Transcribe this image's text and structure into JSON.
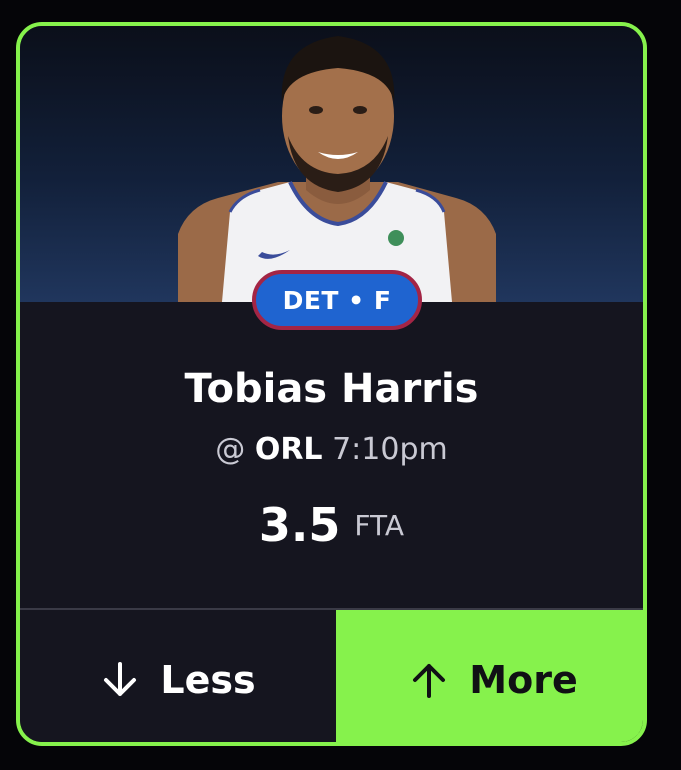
{
  "colors": {
    "accent": "#86f24c",
    "card_bg": "#15151f",
    "badge_bg": "#1f64d0",
    "badge_border": "#a32545"
  },
  "player": {
    "team_position": "DET • F",
    "name": "Tobias Harris",
    "opponent_prefix": "@",
    "opponent": "ORL",
    "game_time": "7:10pm",
    "line_value": "3.5",
    "stat": "FTA"
  },
  "actions": {
    "less_label": "Less",
    "less_icon": "arrow-down-icon",
    "more_label": "More",
    "more_icon": "arrow-up-icon"
  }
}
